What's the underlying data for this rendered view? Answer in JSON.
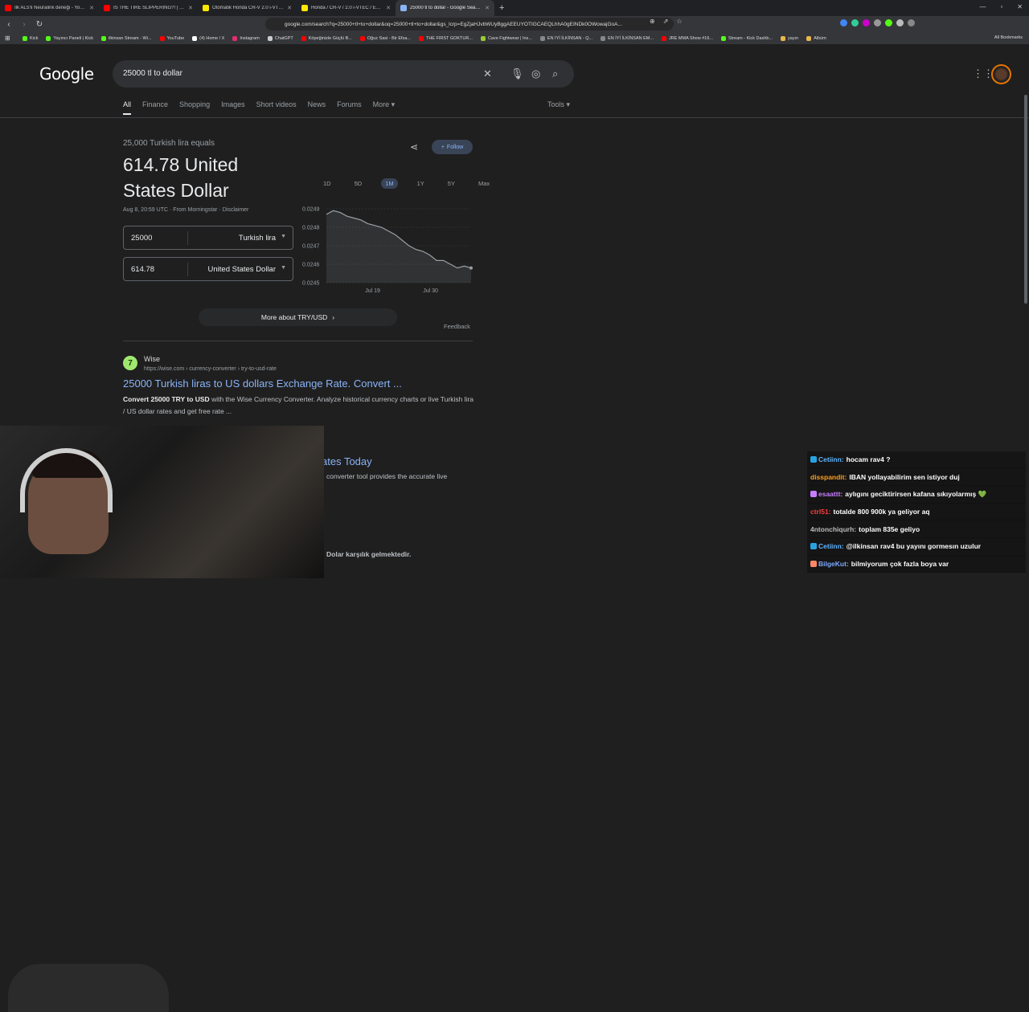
{
  "browser": {
    "tabs": [
      {
        "label": "İlk ALS'li Neuralink deneği - YouTube",
        "icon": "youtube-icon",
        "color": "#ff0000",
        "active": false
      },
      {
        "label": "IS THE TIRE SLIPPERING?! | 55rides | ...",
        "icon": "youtube-icon",
        "color": "#ff0000",
        "active": false
      },
      {
        "label": "Otomatik Honda CR-V 2.0 i-VTEC Fiy...",
        "icon": "sahibinden-icon",
        "color": "#ffe800",
        "active": false
      },
      {
        "label": "Honda / CR-V / 2.0 i-VTEC / ES / 38...",
        "icon": "sahibinden-icon",
        "color": "#ffe800",
        "active": false
      },
      {
        "label": "25000 tl to dollar - Google Search",
        "icon": "google-icon",
        "color": "#8ab4f8",
        "active": true
      }
    ],
    "new_tab": "+",
    "url": "google.com/search?q=25000+tl+to+dollar&oq=25000+tl+to+dollar&gs_lcrp=EgZjaHJvbWUyBggAEEUYOTIGCAEQLhhA0gEINDk0OWowajGoA...",
    "bookmarks": [
      {
        "label": "Kick",
        "color": "#53fc18"
      },
      {
        "label": "Yayıncı Paneli | Kick",
        "color": "#53fc18"
      },
      {
        "label": "ilkinsan Stream - Wi...",
        "color": "#53fc18"
      },
      {
        "label": "YouTube",
        "color": "#ff0000"
      },
      {
        "label": "(4) Home / X",
        "color": "#ffffff"
      },
      {
        "label": "Instagram",
        "color": "#e1306c"
      },
      {
        "label": "ChatGPT",
        "color": "#cccccc"
      },
      {
        "label": "Köpeğinizle Güçlü B...",
        "color": "#ff0000"
      },
      {
        "label": "Oğuz Sasi - Bir Efsa...",
        "color": "#ff0000"
      },
      {
        "label": "THE FIRST GOKTUR...",
        "color": "#ff0000"
      },
      {
        "label": "Cave Fightwear | Ins...",
        "color": "#9acd32"
      },
      {
        "label": "EN İYİ İLKİNSAN - Q...",
        "color": "#888888"
      },
      {
        "label": "EN İYİ İLKİNSAN EM...",
        "color": "#888888"
      },
      {
        "label": "JRE MMA Show #16...",
        "color": "#ff0000"
      },
      {
        "label": "Stream - Kick Dashb...",
        "color": "#53fc18"
      },
      {
        "label": "yayın",
        "color": "#e8b84a"
      },
      {
        "label": "Albüm",
        "color": "#e8b84a"
      }
    ],
    "all_bookmarks": "All Bookmarks"
  },
  "search": {
    "logo": "Google",
    "query": "25000 tl to dollar",
    "filters": [
      "All",
      "Finance",
      "Shopping",
      "Images",
      "Short videos",
      "News",
      "Forums",
      "More ▾"
    ],
    "tools": "Tools ▾"
  },
  "converter": {
    "equals_text": "25,000 Turkish lira equals",
    "result": "614.78 United States Dollar",
    "follow": "Follow",
    "meta": "Aug 8, 20:59 UTC · From Morningstar · Disclaimer",
    "from_amount": "25000",
    "from_currency": "Turkish lira",
    "to_amount": "614.78",
    "to_currency": "United States Dollar",
    "ranges": [
      "1D",
      "5D",
      "1M",
      "1Y",
      "5Y",
      "Max"
    ],
    "active_range": "1M",
    "more_about": "More about TRY/USD",
    "feedback": "Feedback"
  },
  "chart_data": {
    "type": "area",
    "y_ticks": [
      "0.0249",
      "0.0248",
      "0.0247",
      "0.0246",
      "0.0245"
    ],
    "x_ticks": [
      "Jul 19",
      "Jul 30"
    ],
    "ylim": [
      0.0245,
      0.0249
    ],
    "values": [
      0.02487,
      0.02489,
      0.02488,
      0.02486,
      0.02485,
      0.02484,
      0.02482,
      0.02481,
      0.0248,
      0.02478,
      0.02476,
      0.02473,
      0.0247,
      0.02468,
      0.02467,
      0.02465,
      0.02462,
      0.02462,
      0.0246,
      0.02458,
      0.02459,
      0.02458
    ],
    "line_color": "#9aa0a6"
  },
  "results": [
    {
      "site": "Wise",
      "url": "https://wise.com › currency-converter › try-to-usd-rate",
      "title": "25000 Turkish liras to US dollars Exchange Rate. Convert ...",
      "snippet_bold": "Convert 25000 TRY to USD",
      "snippet": " with the Wise Currency Converter. Analyze historical currency charts or live Turkish lira / US dollar rates and get free rate ..."
    }
  ],
  "partial_result": {
    "title": "ates Today",
    "snippet": "converter tool provides the accurate live",
    "snippet2": "Dolar karşılık gelmektedir."
  },
  "chat": [
    {
      "user": "Cetiinn:",
      "msg": "hocam rav4 ?",
      "color": "#5fb4ff",
      "badge": "#29a3e0"
    },
    {
      "user": "disspandit:",
      "msg": "IBAN yollayabilirim sen istiyor duj",
      "color": "#ff9f1a",
      "badge": ""
    },
    {
      "user": "esaattt:",
      "msg": "aylıgını geciktirirsen kafana sıkıyolarmış 💚",
      "color": "#c77dff",
      "badge": "#c77dff"
    },
    {
      "user": "ctrl51:",
      "msg": "totalde 800 900k ya geliyor aq",
      "color": "#ff3b3b",
      "badge": ""
    },
    {
      "user": "4ntonchiqurh:",
      "msg": "toplam 835e geliyo",
      "color": "#bbbbbb",
      "badge": ""
    },
    {
      "user": "Cetiinn:",
      "msg": "@ilkinsan rav4 bu yayını gormesın uzulur",
      "color": "#5fb4ff",
      "badge": "#29a3e0"
    },
    {
      "user": "BilgeKut:",
      "msg": "bilmiyorum çok fazla boya var",
      "color": "#7da9ff",
      "badge": "#ff8866"
    }
  ]
}
